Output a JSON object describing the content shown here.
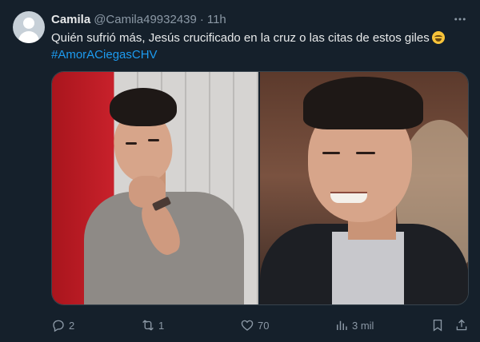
{
  "tweet": {
    "author_name": "Camila",
    "author_handle": "@Camila49932439",
    "separator": "·",
    "time": "11h",
    "text_line1": "Quién sufrió más, Jesús crucificado en la cruz o las citas de estos giles",
    "hashtag": "#AmorACiegasCHV",
    "emoji": "rolling-on-floor-laughing-emoji"
  },
  "actions": {
    "replies": "2",
    "retweets": "1",
    "likes": "70",
    "views": "3 mil"
  },
  "icons": {
    "more": "more-horizontal-icon",
    "reply": "reply-icon",
    "retweet": "retweet-icon",
    "like": "heart-icon",
    "views": "views-chart-icon",
    "bookmark": "bookmark-icon",
    "share": "share-icon"
  },
  "colors": {
    "background": "#15202b",
    "text": "#e7e9ea",
    "muted": "#8b98a5",
    "accent": "#1d9bf0",
    "border": "#38444d"
  }
}
